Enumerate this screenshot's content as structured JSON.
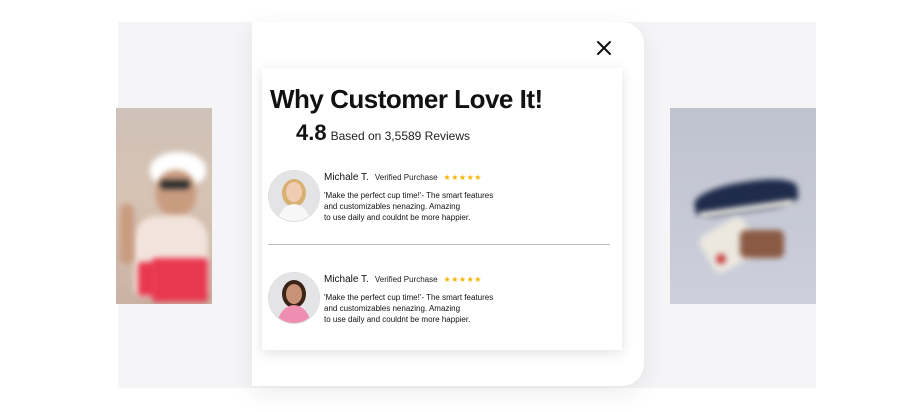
{
  "modal": {
    "title": "Why Customer Love It!",
    "rating_value": "4.8",
    "rating_text": "Based on 3,5589 Reviews",
    "close_icon": "close-icon"
  },
  "reviews": [
    {
      "name": "Michale T.",
      "badge": "Verified Purchase",
      "stars": "★★★★★",
      "body_lines": [
        "'Make the perfect cup time!'- The smart features",
        "and customizables nenazing. Amazing",
        "to use daily  and couldnt be more happier."
      ]
    },
    {
      "name": "Michale T.",
      "badge": "Verified Purchase",
      "stars": "★★★★★",
      "body_lines": [
        "'Make the perfect cup time!'- The smart features",
        "and customizables nenazing. Amazing",
        "to use daily  and couldnt be more happier."
      ]
    }
  ],
  "colors": {
    "star": "#f5b400",
    "backdrop": "#f5f5f8",
    "divider": "#bdbdbd"
  }
}
